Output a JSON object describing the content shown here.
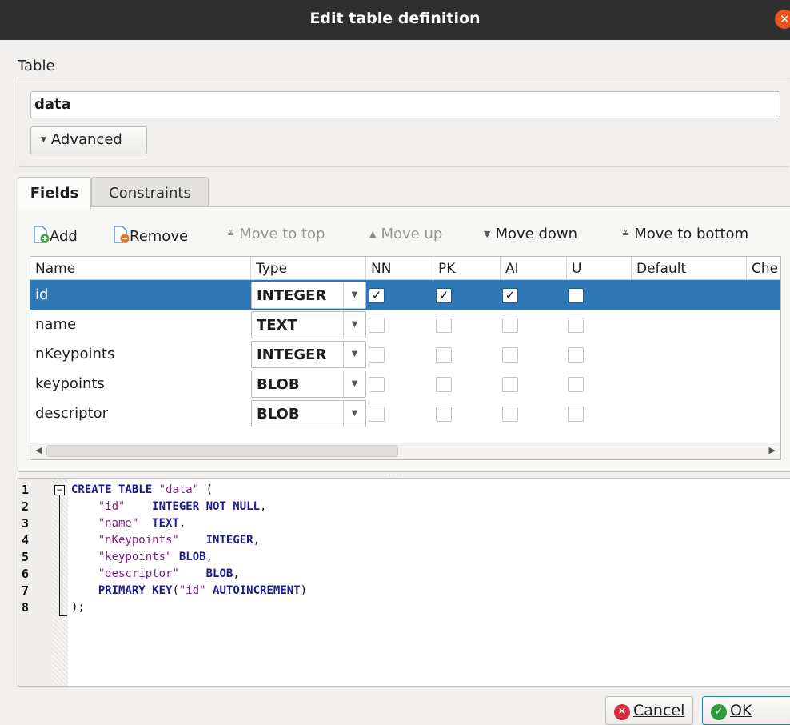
{
  "window": {
    "title": "Edit table definition"
  },
  "table": {
    "label": "Table",
    "name": "data",
    "advanced_label": "Advanced"
  },
  "tabs": [
    {
      "label": "Fields"
    },
    {
      "label": "Constraints"
    }
  ],
  "toolbar": {
    "add": "Add",
    "remove": "Remove",
    "move_top": "Move to top",
    "move_up": "Move up",
    "move_down": "Move down",
    "move_bottom": "Move to bottom"
  },
  "grid": {
    "headers": [
      "Name",
      "Type",
      "NN",
      "PK",
      "AI",
      "U",
      "Default",
      "Che"
    ],
    "rows": [
      {
        "name": "id",
        "type": "INTEGER",
        "nn": true,
        "pk": true,
        "ai": true,
        "u": false,
        "selected": true
      },
      {
        "name": "name",
        "type": "TEXT",
        "nn": false,
        "pk": false,
        "ai": false,
        "u": false,
        "selected": false
      },
      {
        "name": "nKeypoints",
        "type": "INTEGER",
        "nn": false,
        "pk": false,
        "ai": false,
        "u": false,
        "selected": false
      },
      {
        "name": "keypoints",
        "type": "BLOB",
        "nn": false,
        "pk": false,
        "ai": false,
        "u": false,
        "selected": false
      },
      {
        "name": "descriptor",
        "type": "BLOB",
        "nn": false,
        "pk": false,
        "ai": false,
        "u": false,
        "selected": false
      }
    ]
  },
  "sql": {
    "line_numbers": [
      "1",
      "2",
      "3",
      "4",
      "5",
      "6",
      "7",
      "8"
    ],
    "lines": [
      [
        {
          "t": "CREATE TABLE",
          "c": "kw"
        },
        {
          "t": " "
        },
        {
          "t": "\"data\"",
          "c": "str"
        },
        {
          "t": " ("
        }
      ],
      [
        {
          "t": "    "
        },
        {
          "t": "\"id\"",
          "c": "str"
        },
        {
          "t": "    "
        },
        {
          "t": "INTEGER NOT NULL",
          "c": "kw"
        },
        {
          "t": ","
        }
      ],
      [
        {
          "t": "    "
        },
        {
          "t": "\"name\"",
          "c": "str"
        },
        {
          "t": "  "
        },
        {
          "t": "TEXT",
          "c": "kw"
        },
        {
          "t": ","
        }
      ],
      [
        {
          "t": "    "
        },
        {
          "t": "\"nKeypoints\"",
          "c": "str"
        },
        {
          "t": "    "
        },
        {
          "t": "INTEGER",
          "c": "kw"
        },
        {
          "t": ","
        }
      ],
      [
        {
          "t": "    "
        },
        {
          "t": "\"keypoints\"",
          "c": "str"
        },
        {
          "t": " "
        },
        {
          "t": "BLOB",
          "c": "kw"
        },
        {
          "t": ","
        }
      ],
      [
        {
          "t": "    "
        },
        {
          "t": "\"descriptor\"",
          "c": "str"
        },
        {
          "t": "    "
        },
        {
          "t": "BLOB",
          "c": "kw"
        },
        {
          "t": ","
        }
      ],
      [
        {
          "t": "    "
        },
        {
          "t": "PRIMARY KEY",
          "c": "kw"
        },
        {
          "t": "("
        },
        {
          "t": "\"id\"",
          "c": "str"
        },
        {
          "t": " "
        },
        {
          "t": "AUTOINCREMENT",
          "c": "kw"
        },
        {
          "t": ")"
        }
      ],
      [
        {
          "t": ");"
        }
      ]
    ]
  },
  "buttons": {
    "cancel_label": "Cancel",
    "ok_label": "OK"
  },
  "icons": {
    "close": "close-icon",
    "add": "add-field-icon",
    "remove": "remove-field-icon",
    "cancel": "cancel-icon",
    "ok": "ok-icon"
  },
  "colors": {
    "titlebar": "#2f2f2f",
    "selection": "#2f78b7",
    "close": "#e95420",
    "ok_green": "#2e9b3c",
    "cancel_red": "#d62b3a"
  }
}
